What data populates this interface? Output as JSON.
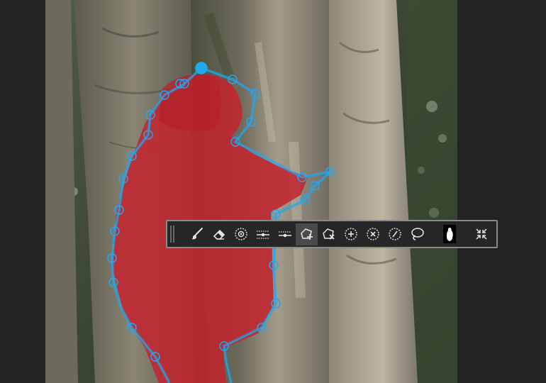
{
  "colors": {
    "background": "#232323",
    "toolbar_bg": "#262626",
    "toolbar_border": "#8a8a8a",
    "selection_overlay": "#d02a3c",
    "polygon_accent": "#22a7f0",
    "icon": "#e6e6e6"
  },
  "toolbar": {
    "tools": [
      {
        "id": "brush",
        "icon": "brush-icon",
        "active": false
      },
      {
        "id": "eraser",
        "icon": "eraser-icon",
        "active": false
      },
      {
        "id": "point",
        "icon": "crosshair-point-icon",
        "active": false
      },
      {
        "id": "threshold-up",
        "icon": "threshold-slider-up-icon",
        "active": false
      },
      {
        "id": "threshold-down",
        "icon": "threshold-slider-down-icon",
        "active": false
      },
      {
        "id": "polygon-add",
        "icon": "polygon-add-icon",
        "active": true
      },
      {
        "id": "polygon-remove",
        "icon": "polygon-remove-icon",
        "active": false
      },
      {
        "id": "point-add",
        "icon": "point-add-icon",
        "active": false
      },
      {
        "id": "point-remove",
        "icon": "point-remove-icon",
        "active": false
      },
      {
        "id": "point-slash",
        "icon": "point-slash-icon",
        "active": false
      },
      {
        "id": "lasso",
        "icon": "lasso-icon",
        "active": false
      }
    ],
    "mask_icon": "mask-preview-icon",
    "collapse_icon": "collapse-arrows-icon"
  }
}
